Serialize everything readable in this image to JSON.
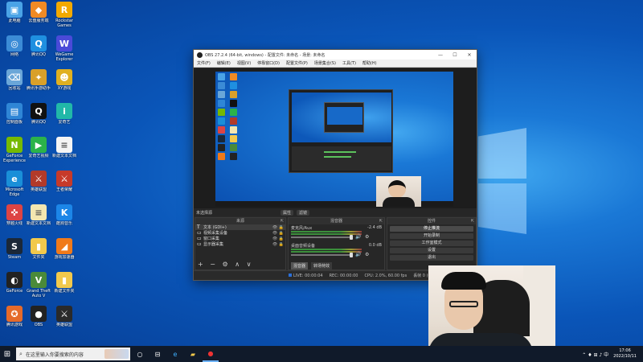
{
  "desktop": {
    "icons": [
      {
        "label": "此电脑",
        "color": "#4aa3e6",
        "glyph": "▣"
      },
      {
        "label": "云盘服务端",
        "color": "#f08a24",
        "glyph": "◆"
      },
      {
        "label": "Rockstar Games",
        "color": "#f2a900",
        "glyph": "R"
      },
      {
        "label": "网络",
        "color": "#3b8bd6",
        "glyph": "◎"
      },
      {
        "label": "腾讯QQ",
        "color": "#1f8fe0",
        "glyph": "Q"
      },
      {
        "label": "WeGame Explorer",
        "color": "#4a4ad8",
        "glyph": "W"
      },
      {
        "label": "回收站",
        "color": "#6aa6d8",
        "glyph": "⌫"
      },
      {
        "label": "腾讯手游助手",
        "color": "#d9a02a",
        "glyph": "✦"
      },
      {
        "label": "XY游戏",
        "color": "#e0b020",
        "glyph": "☻"
      },
      {
        "label": "控制面板",
        "color": "#2f86d6",
        "glyph": "▤"
      },
      {
        "label": "腾讯QQ",
        "color": "#111",
        "glyph": "Q"
      },
      {
        "label": "爱奇艺",
        "color": "#21b8a8",
        "glyph": "i"
      },
      {
        "label": "GeForce Experience",
        "color": "#76b900",
        "glyph": "N"
      },
      {
        "label": "爱奇艺视频",
        "color": "#2bb34a",
        "glyph": "▶"
      },
      {
        "label": "新建文本文档",
        "color": "#f4f4f4",
        "glyph": "≡"
      },
      {
        "label": "Microsoft Edge",
        "color": "#1a8fd8",
        "glyph": "e"
      },
      {
        "label": "英雄联盟",
        "color": "#b23a2a",
        "glyph": "⚔"
      },
      {
        "label": "王者荣耀",
        "color": "#c63a2a",
        "glyph": "⚔"
      },
      {
        "label": "穿越火线",
        "color": "#d44",
        "glyph": "✜"
      },
      {
        "label": "新建文本文档",
        "color": "#f3e6b0",
        "glyph": "≡"
      },
      {
        "label": "酷狗音乐",
        "color": "#1c86e8",
        "glyph": "K"
      },
      {
        "label": "Steam",
        "color": "#1b2838",
        "glyph": "S"
      },
      {
        "label": "文件夹",
        "color": "#f2c94c",
        "glyph": "▮"
      },
      {
        "label": "游戏加速器",
        "color": "#f07a1a",
        "glyph": "◢"
      },
      {
        "label": "GeForce",
        "color": "#222",
        "glyph": "◐"
      },
      {
        "label": "Grand Theft Auto V",
        "color": "#4a8a3a",
        "glyph": "V"
      },
      {
        "label": "新建文件夹",
        "color": "#f2c94c",
        "glyph": "▮"
      },
      {
        "label": "腾讯游戏",
        "color": "#e56a2a",
        "glyph": "✪"
      },
      {
        "label": "OBS",
        "color": "#222",
        "glyph": "●"
      },
      {
        "label": "英雄联盟",
        "color": "#2a2a2a",
        "glyph": "⚔"
      }
    ]
  },
  "obs": {
    "title": "OBS 27.2.4 (64-bit, windows) - 配置文件: 未命名 - 场景: 未命名",
    "window_controls": {
      "minimize": "—",
      "maximize": "☐",
      "close": "✕"
    },
    "menu": [
      "文件(F)",
      "编辑(E)",
      "视图(V)",
      "停靠窗口(D)",
      "配置文件(P)",
      "场景集合(S)",
      "工具(T)",
      "帮助(H)"
    ],
    "scene_label": "未选择源",
    "scene_buttons": [
      "属性",
      "滤镜"
    ],
    "docks": {
      "sources": {
        "header": "来源",
        "items": [
          {
            "kind": "T",
            "name": "文本 (GDI+)",
            "selected": true
          },
          {
            "kind": "▭",
            "name": "视频采集设备",
            "selected": false
          },
          {
            "kind": "▭",
            "name": "窗口采集",
            "selected": false
          },
          {
            "kind": "▭",
            "name": "显示器采集",
            "selected": false
          }
        ],
        "tools": "+ − ⚙ ∧ ∨"
      },
      "mixer": {
        "header": "混音器",
        "channels": [
          {
            "name": "麦克风/Aux",
            "db": "-2.4 dB"
          },
          {
            "name": "桌面音频设备",
            "db": "0.0 dB"
          }
        ],
        "tabs": [
          "混音器",
          "转场特效"
        ]
      },
      "controls": {
        "header": "控件",
        "buttons": [
          "停止推流",
          "开始录制",
          "工作室模式",
          "设置",
          "退出"
        ]
      }
    },
    "status": {
      "live": "LIVE: 00:00:04",
      "rec": "REC: 00:00:00",
      "cpu": "CPU: 2.0%, 60.00 fps",
      "drops": "丢帧 0 (0.0%)"
    }
  },
  "taskbar": {
    "search_placeholder": "在这里输入你要搜索的内容",
    "apps": [
      "○",
      "⊟",
      "e",
      "▰",
      "●"
    ],
    "tray": {
      "icons": "⌃ ♦ ⊞ ♪ 中",
      "time": "17:06",
      "date": "2022/10/11"
    }
  },
  "colors": {
    "accent": "#0a55b8",
    "obs_bg": "#2a2a2a",
    "meter_green": "#3b8f3b"
  }
}
